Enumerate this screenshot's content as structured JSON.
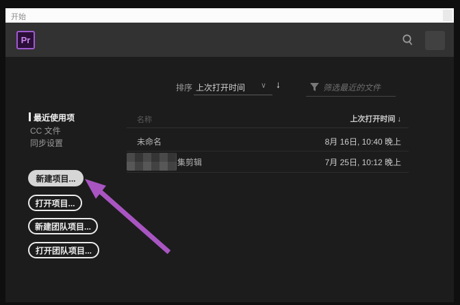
{
  "window": {
    "title": "开始"
  },
  "header": {
    "logo_label": "Pr",
    "search_icon": "magnifier",
    "avatar": "account-square"
  },
  "toolbar": {
    "sort_label": "排序",
    "sort_value": "上次打开时间",
    "chevron_glyph": "∨",
    "sort_direction_glyph": "↓",
    "filter_placeholder": "筛选最近的文件"
  },
  "sidebar": {
    "items": [
      {
        "label": "最近使用项",
        "active": true
      },
      {
        "label": "CC 文件",
        "active": false
      },
      {
        "label": "同步设置",
        "active": false
      }
    ],
    "buttons": [
      {
        "label": "新建项目...",
        "style": "filled"
      },
      {
        "label": "打开项目...",
        "style": "outline"
      },
      {
        "label": "新建团队项目...",
        "style": "outline"
      },
      {
        "label": "打开团队项目...",
        "style": "outline"
      }
    ]
  },
  "recent_files": {
    "name_header": "名称",
    "date_header": "上次打开时间 ↓",
    "rows": [
      {
        "name": "未命名",
        "censored": false,
        "date": "8月 16日, 10:40 晚上"
      },
      {
        "name": "集剪辑",
        "censored": true,
        "date": "7月 25日, 10:12 晚上"
      }
    ]
  },
  "annotation": {
    "type": "arrow",
    "color": "#a855c2",
    "points_to": "新建项目..."
  },
  "colors": {
    "accent_purple": "#a05ad2",
    "logo_text": "#c887ea",
    "titlebar_bg": "#fbfbfb",
    "header_bg": "#323232",
    "main_bg": "#1c1c1c",
    "arrow": "#a855c2"
  }
}
